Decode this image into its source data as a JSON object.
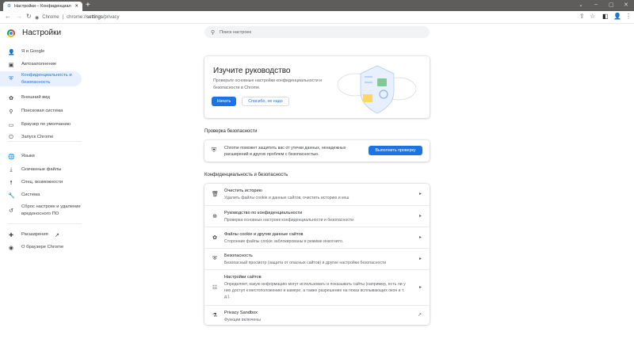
{
  "browser": {
    "tab_title": "Настройки – Конфиденциальность",
    "tab_close": "✕",
    "new_tab": "+",
    "omnibox_site": "Chrome",
    "omnibox_url_prefix": "chrome://",
    "omnibox_url_bold": "settings",
    "omnibox_url_suffix": "/privacy",
    "win": [
      "⌄",
      "–",
      "▢",
      "✕"
    ]
  },
  "header": {
    "title": "Настройки",
    "search_placeholder": "Поиск настроек"
  },
  "sidebar": {
    "items": [
      {
        "label": "Я и Google",
        "icon": "person-icon",
        "glyph": "👤"
      },
      {
        "label": "Автозаполнение",
        "icon": "clipboard-icon",
        "glyph": "▣"
      },
      {
        "label": "Конфиденциальность и безопасность",
        "icon": "shield-icon",
        "glyph": "⛨"
      },
      {
        "label": "Внешний вид",
        "icon": "palette-icon",
        "glyph": "✿"
      },
      {
        "label": "Поисковая система",
        "icon": "search-icon",
        "glyph": "⚲"
      },
      {
        "label": "Браузер по умолчанию",
        "icon": "browser-icon",
        "glyph": "▭"
      },
      {
        "label": "Запуск Chrome",
        "icon": "power-icon",
        "glyph": "⏻"
      },
      {
        "label": "Языки",
        "icon": "globe-icon",
        "glyph": "🌐"
      },
      {
        "label": "Скачанные файлы",
        "icon": "download-icon",
        "glyph": "⤓"
      },
      {
        "label": "Спец. возможности",
        "icon": "accessibility-icon",
        "glyph": "☨"
      },
      {
        "label": "Система",
        "icon": "wrench-icon",
        "glyph": "🔧"
      },
      {
        "label": "Сброс настроек и удаление вредоносного ПО",
        "icon": "reset-icon",
        "glyph": "↺"
      },
      {
        "label": "Расширения",
        "icon": "puzzle-icon",
        "glyph": "✚",
        "ext": "↗"
      },
      {
        "label": "О браузере Chrome",
        "icon": "chrome-icon",
        "glyph": "◉"
      }
    ]
  },
  "guide": {
    "title": "Изучите руководство",
    "text": "Проверьте основные настройки конфиденциальности и безопасности в Chrome.",
    "start": "Начать",
    "dismiss": "Спасибо, не надо"
  },
  "safety": {
    "heading": "Проверка безопасности",
    "text": "Chrome поможет защитить вас от утечки данных, ненадежных расширений и других проблем с безопасностью.",
    "button": "Выполнить проверку"
  },
  "privacy": {
    "heading": "Конфиденциальность и безопасность",
    "rows": [
      {
        "title": "Очистить историю",
        "sub": "Удалить файлы cookie и данные сайтов, очистить историю и кеш",
        "icon": "trash-icon",
        "glyph": "🗑"
      },
      {
        "title": "Руководство по конфиденциальности",
        "sub": "Проверка основных настроек конфиденциальности и безопасности",
        "icon": "add-circle-icon",
        "glyph": "⊕"
      },
      {
        "title": "Файлы cookie и другие данные сайтов",
        "sub": "Сторонние файлы cookie заблокированы в режиме инкогнито.",
        "icon": "cookie-icon",
        "glyph": "✿"
      },
      {
        "title": "Безопасность",
        "sub": "Безопасный просмотр (защита от опасных сайтов) и другие настройки безопасности",
        "icon": "shield-icon",
        "glyph": "⛨"
      },
      {
        "title": "Настройки сайтов",
        "sub": "Определяет, какую информацию могут использовать и показывать сайты (например, есть ли у них доступ к местоположению и камере, а также разрешение на показ всплывающих окон и т. д.).",
        "icon": "tune-icon",
        "glyph": "☷"
      },
      {
        "title": "Privacy Sandbox",
        "sub": "Функции включены",
        "icon": "flask-icon",
        "glyph": "⚗"
      }
    ]
  }
}
